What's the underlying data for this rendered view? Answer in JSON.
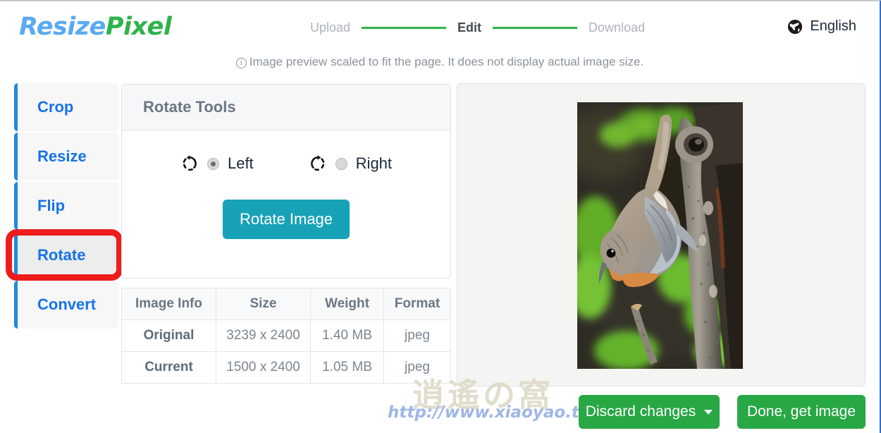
{
  "header": {
    "logo_part1": "Resize",
    "logo_part2": "Pixel",
    "steps": [
      {
        "label": "Upload",
        "state": "done"
      },
      {
        "label": "Edit",
        "state": "active"
      },
      {
        "label": "Download",
        "state": "todo"
      }
    ],
    "language": "English",
    "language_icon": "globe-icon"
  },
  "notice": {
    "icon": "info-circle-icon",
    "text": "Image preview scaled to fit the page. It does not display actual image size."
  },
  "sidebar": {
    "items": [
      {
        "label": "Crop",
        "selected": false
      },
      {
        "label": "Resize",
        "selected": false
      },
      {
        "label": "Flip",
        "selected": false
      },
      {
        "label": "Rotate",
        "selected": true
      },
      {
        "label": "Convert",
        "selected": false
      }
    ],
    "highlight_color": "#ee1c1c",
    "accent_color": "#1673e8"
  },
  "tool_panel": {
    "title": "Rotate Tools",
    "options": [
      {
        "label": "Left",
        "icon": "rotate-left-icon",
        "checked": true
      },
      {
        "label": "Right",
        "icon": "rotate-right-icon",
        "checked": false
      }
    ],
    "action_button": "Rotate Image",
    "action_color": "#17a2b8"
  },
  "image_info": {
    "headers": [
      "Image Info",
      "Size",
      "Weight",
      "Format"
    ],
    "rows": [
      {
        "name": "Original",
        "size": "3239 x 2400",
        "weight": "1.40 MB",
        "format": "jpeg"
      },
      {
        "name": "Current",
        "size": "1500 x 2400",
        "weight": "1.05 MB",
        "format": "jpeg"
      }
    ]
  },
  "preview": {
    "alt": "bird-photo-preview"
  },
  "watermark": {
    "cjk": "逍遙の窩",
    "url": "http://www.xiaoyao.tw/"
  },
  "footer": {
    "discard_label": "Discard changes",
    "done_label": "Done, get image",
    "button_color": "#28a745"
  }
}
